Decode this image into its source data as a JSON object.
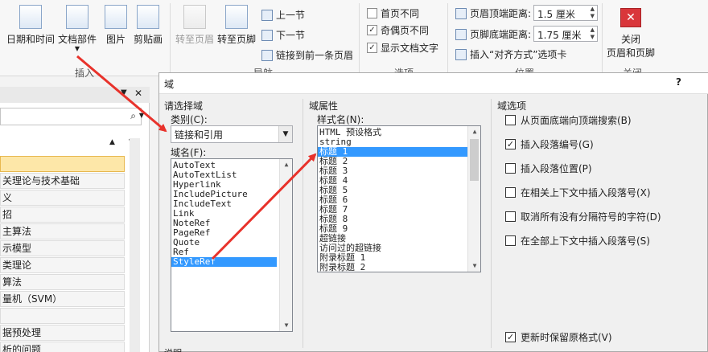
{
  "ribbon": {
    "buttons": {
      "date_time": "日期和时间",
      "doc_parts": "文档部件",
      "picture": "图片",
      "clipart": "剪贴画",
      "goto_header": "转至页眉",
      "goto_footer": "转至页脚",
      "close_line1": "关闭",
      "close_line2": "页眉和页脚"
    },
    "nav": {
      "prev": "上一节",
      "next": "下一节",
      "link_prev": "链接到前一条页眉"
    },
    "options": {
      "diff_first": "首页不同",
      "diff_odd_even": "奇偶页不同",
      "show_doc_text": "显示文档文字",
      "diff_first_checked": false,
      "diff_odd_even_checked": true,
      "show_doc_text_checked": true
    },
    "position": {
      "header_top_label": "页眉顶端距离:",
      "header_top_value": "1.5 厘米",
      "footer_bottom_label": "页脚底端距离:",
      "footer_bottom_value": "1.75 厘米",
      "insert_align_tab": "插入“对齐方式”选项卡"
    },
    "groups": {
      "insert": "插入",
      "navigation": "导航",
      "options": "选项",
      "position": "位置",
      "close": "关闭"
    }
  },
  "nav_pane": {
    "items": [
      "",
      "关理论与技术基础",
      "义",
      "招",
      "主算法",
      "示模型",
      "类理论",
      "算法",
      "量机（SVM）",
      "",
      "据预处理",
      "析的问题"
    ]
  },
  "dialog": {
    "title": "域",
    "help": "?",
    "choose_field": "请选择域",
    "category_label": "类别(C):",
    "category_value": "链接和引用",
    "field_names_label": "域名(F):",
    "field_names": [
      "AutoText",
      "AutoTextList",
      "Hyperlink",
      "IncludePicture",
      "IncludeText",
      "Link",
      "NoteRef",
      "PageRef",
      "Quote",
      "Ref",
      "StyleRef"
    ],
    "field_names_selected": 10,
    "field_props": "域属性",
    "style_name_label": "样式名(N):",
    "style_names": [
      "HTML 预设格式",
      "string",
      "标题 1",
      "标题 2",
      "标题 3",
      "标题 4",
      "标题 5",
      "标题 6",
      "标题 7",
      "标题 8",
      "标题 9",
      "超链接",
      "访问过的超链接",
      "附录标题 1",
      "附录标题 2"
    ],
    "style_names_selected": 2,
    "field_options": "域选项",
    "options": [
      {
        "label": "从页面底端向顶端搜索(B)",
        "checked": false
      },
      {
        "label": "插入段落编号(G)",
        "checked": true
      },
      {
        "label": "插入段落位置(P)",
        "checked": false
      },
      {
        "label": "在相关上下文中插入段落号(X)",
        "checked": false
      },
      {
        "label": "取消所有没有分隔符号的字符(D)",
        "checked": false
      },
      {
        "label": "在全部上下文中插入段落号(S)",
        "checked": false
      }
    ],
    "preserve_format": {
      "label": "更新时保留原格式(V)",
      "checked": true
    },
    "description_label": "说明"
  },
  "colors": {
    "selection": "#3399ff",
    "annotation_arrow": "#e8322b",
    "nav_active": "#fde7a8"
  }
}
